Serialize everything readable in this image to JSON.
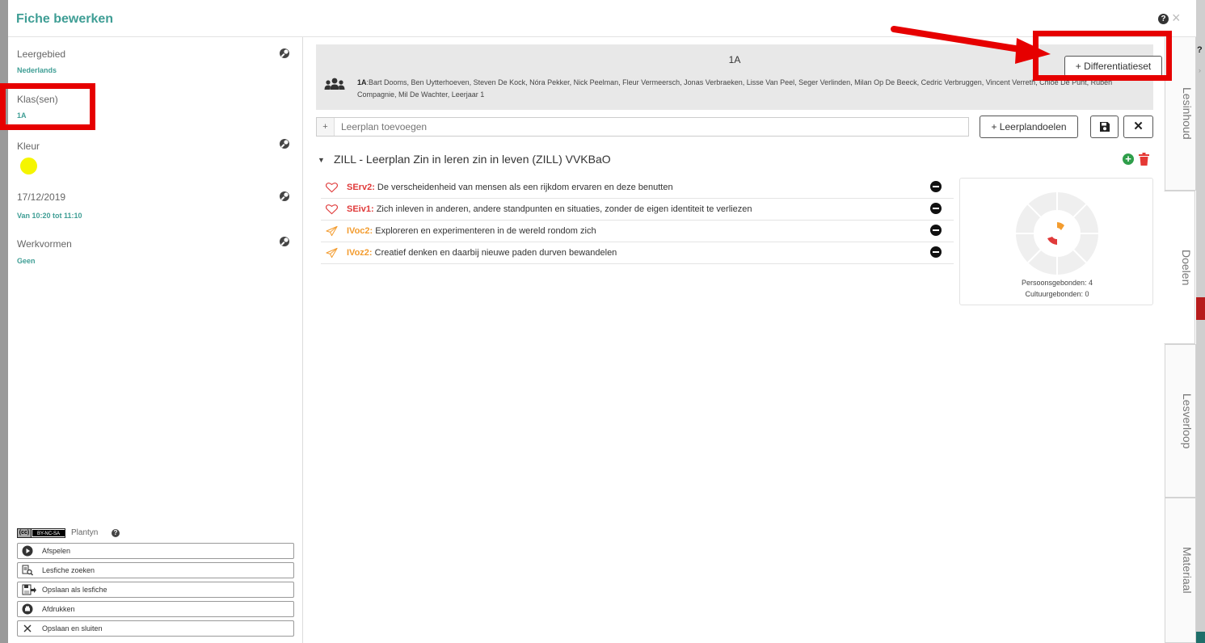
{
  "window": {
    "title": "Fiche bewerken",
    "help_icon": "question-circle-icon",
    "close_icon": "close-icon",
    "help_glyph": "?",
    "close_glyph": "×"
  },
  "sidebar": {
    "leergebied": {
      "label": "Leergebied",
      "value": "Nederlands"
    },
    "klassen": {
      "label": "Klas(sen)",
      "value": "1A"
    },
    "kleur": {
      "label": "Kleur",
      "value": "#f5f500"
    },
    "datum": {
      "label": "17/12/2019",
      "value": "Van 10:20 tot 11:10"
    },
    "werkvormen": {
      "label": "Werkvormen",
      "value": "Geen"
    },
    "edit_icon": "wrench-icon",
    "license": {
      "badge_cc": "(cc)",
      "badge_text": "BY-NC-SA",
      "publisher": "Plantyn",
      "help_glyph": "?"
    },
    "actions": [
      {
        "label": "Afspelen",
        "icon": "play-circle-icon"
      },
      {
        "label": "Lesfiche zoeken",
        "icon": "search-document-icon"
      },
      {
        "label": "Opslaan als lesfiche",
        "icon": "save-export-icon"
      },
      {
        "label": "Afdrukken",
        "icon": "print-icon"
      },
      {
        "label": "Opslaan en sluiten",
        "icon": "close-icon"
      }
    ]
  },
  "main": {
    "class": {
      "name": "1A",
      "members_prefix": "1A",
      "members": ":Bart Dooms, Ben Uytterhoeven, Steven De Kock, Nóra Pekker, Nick Peelman, Fleur Vermeersch, Jonas Verbraeken, Lisse Van Peel, Seger Verlinden, Milan Op De Beeck, Cedric Verbruggen, Vincent Verreth, Chloe De Punt, Ruben Compagnie, Mil De Wachter, Leerjaar 1"
    },
    "diff_button": "+ Differentiatieset",
    "plan_input": {
      "prefix": "+",
      "placeholder": "Leerplan toevoegen"
    },
    "leerplandoelen_button": "+ Leerplandoelen",
    "cancel_glyph": "✕",
    "plan": {
      "caret": "▼",
      "title": "ZILL - Leerplan Zin in leren zin in leven (ZILL) VVKBaO",
      "add_glyph": "+",
      "goals": [
        {
          "code": "SErv2:",
          "text": " De verscheidenheid van mensen als een rijkdom ervaren en deze benutten",
          "icon": "heart-icon",
          "color": "#e03a3a"
        },
        {
          "code": "SEiv1:",
          "text": " Zich inleven in anderen, andere standpunten en situaties, zonder de eigen identiteit te verliezen",
          "icon": "heart-icon",
          "color": "#e03a3a"
        },
        {
          "code": "IVoc2:",
          "text": " Exploreren en experimenteren in de wereld rondom zich",
          "icon": "paper-plane-icon",
          "color": "#f39c2f"
        },
        {
          "code": "IVoz2:",
          "text": " Creatief denken en daarbij nieuwe paden durven bewandelen",
          "icon": "paper-plane-icon",
          "color": "#f39c2f"
        }
      ]
    },
    "chart_card": {
      "legend_persoon": "Persoonsgebonden: 4",
      "legend_cultuur": "Cultuurgebonden: 0"
    }
  },
  "tabs": [
    {
      "label": "Lesinhoud",
      "active": false
    },
    {
      "label": "Doelen",
      "active": true
    },
    {
      "label": "Lesverloop",
      "active": false
    },
    {
      "label": "Materiaal",
      "active": false
    }
  ],
  "annotations": {
    "highlight_color": "#e60000"
  }
}
